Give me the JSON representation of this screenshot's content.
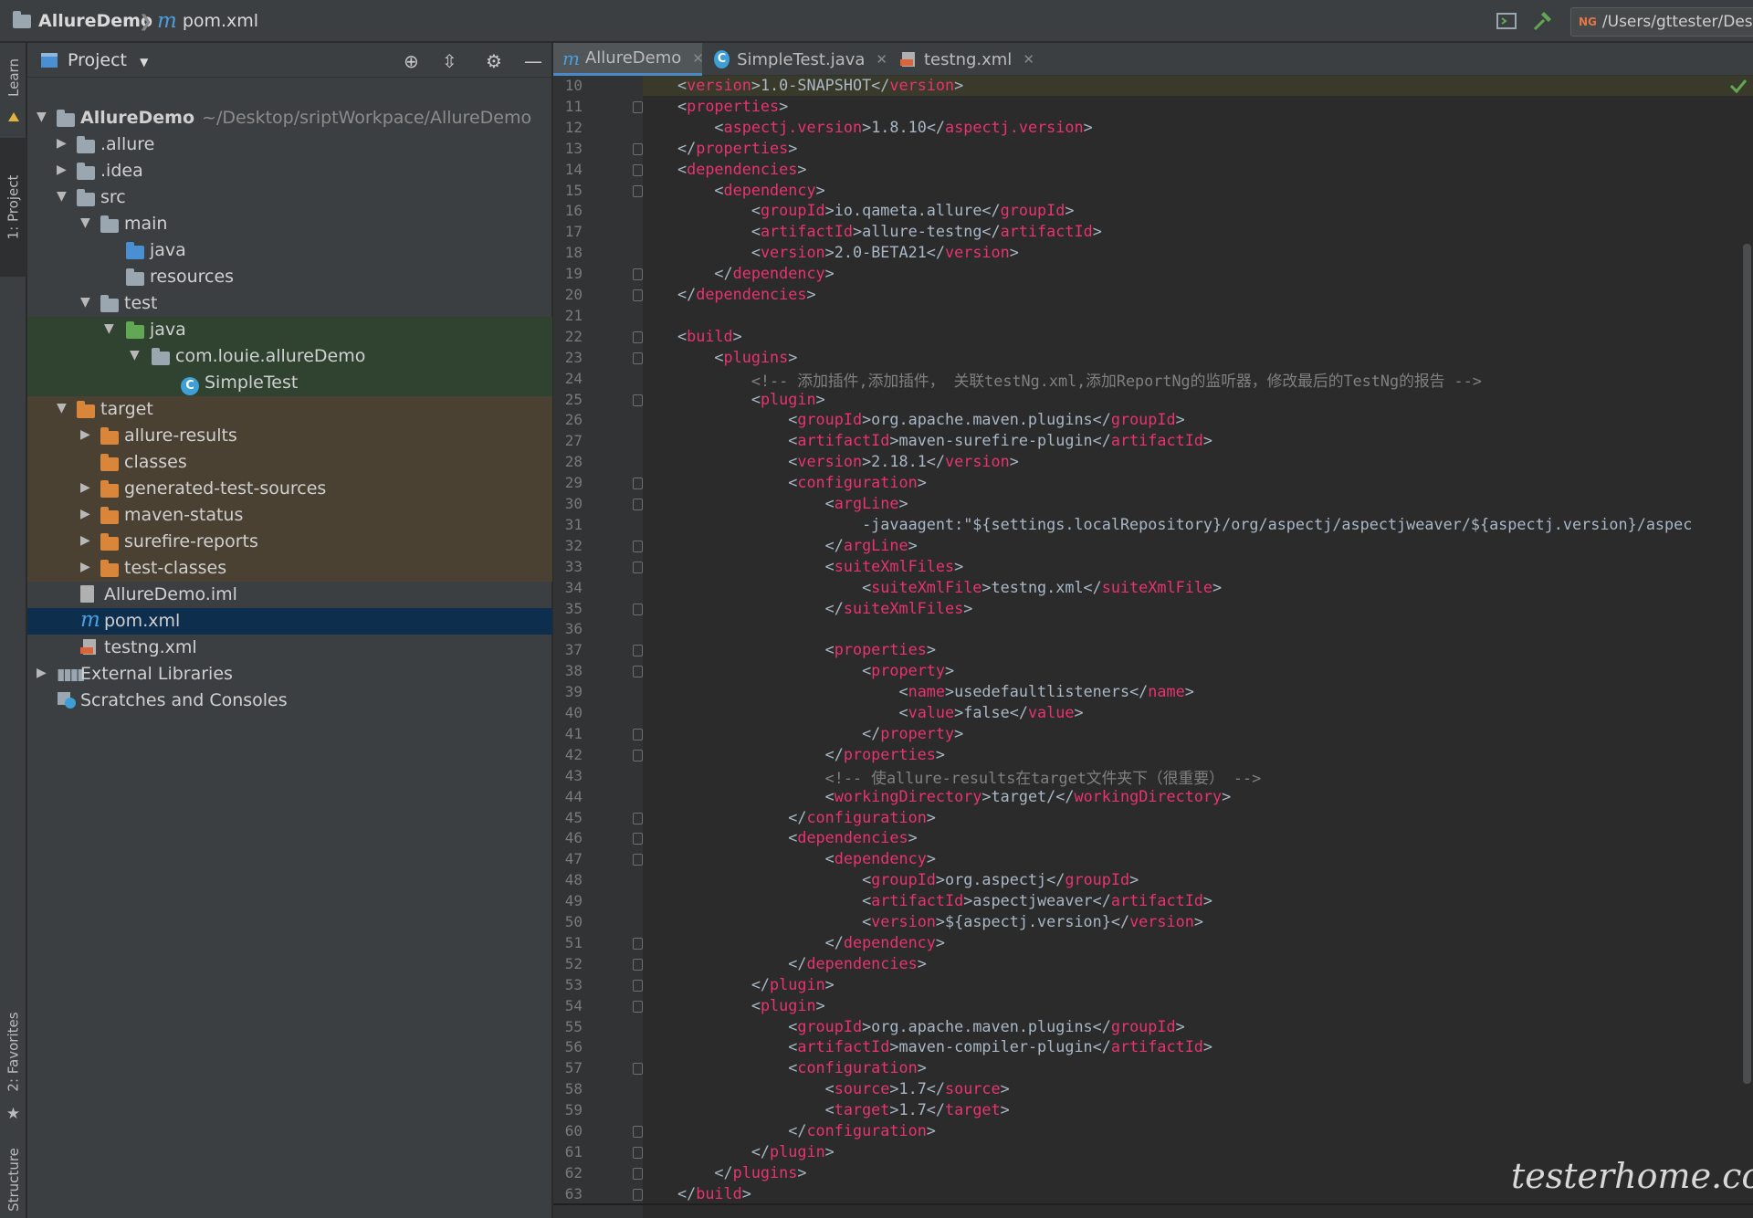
{
  "navbar": {
    "project": "AllureDemo",
    "file": "pom.xml",
    "run_config_badge": "NG",
    "path_field": "/Users/gttester/Desk"
  },
  "stripe": {
    "learn": "Learn",
    "project": "1: Project",
    "favorites": "2: Favorites",
    "structure": "Structure"
  },
  "project_panel": {
    "title": "Project",
    "tree": [
      {
        "label": "AllureDemo",
        "extra": "~/Desktop/sriptWorkpace/AllureDemo"
      },
      {
        "label": ".allure"
      },
      {
        "label": ".idea"
      },
      {
        "label": "src"
      },
      {
        "label": "main"
      },
      {
        "label": "java"
      },
      {
        "label": "resources"
      },
      {
        "label": "test"
      },
      {
        "label": "java"
      },
      {
        "label": "com.louie.allureDemo"
      },
      {
        "label": "SimpleTest"
      },
      {
        "label": "target"
      },
      {
        "label": "allure-results"
      },
      {
        "label": "classes"
      },
      {
        "label": "generated-test-sources"
      },
      {
        "label": "maven-status"
      },
      {
        "label": "surefire-reports"
      },
      {
        "label": "test-classes"
      },
      {
        "label": "AllureDemo.iml"
      },
      {
        "label": "pom.xml"
      },
      {
        "label": "testng.xml"
      },
      {
        "label": "External Libraries"
      },
      {
        "label": "Scratches and Consoles"
      }
    ]
  },
  "tabs": [
    {
      "label": "AllureDemo"
    },
    {
      "label": "SimpleTest.java"
    },
    {
      "label": "testng.xml"
    }
  ],
  "code_lines": [
    {
      "n": "10",
      "text": "<version>1.0-SNAPSHOT</version>"
    },
    {
      "n": "11",
      "text": "<properties>"
    },
    {
      "n": "12",
      "text": "    <aspectj.version>1.8.10</aspectj.version>"
    },
    {
      "n": "13",
      "text": "</properties>"
    },
    {
      "n": "14",
      "text": "<dependencies>"
    },
    {
      "n": "15",
      "text": "    <dependency>"
    },
    {
      "n": "16",
      "text": "        <groupId>io.qameta.allure</groupId>"
    },
    {
      "n": "17",
      "text": "        <artifactId>allure-testng</artifactId>"
    },
    {
      "n": "18",
      "text": "        <version>2.0-BETA21</version>"
    },
    {
      "n": "19",
      "text": "    </dependency>"
    },
    {
      "n": "20",
      "text": "</dependencies>"
    },
    {
      "n": "21",
      "text": ""
    },
    {
      "n": "22",
      "text": "<build>"
    },
    {
      "n": "23",
      "text": "    <plugins>"
    },
    {
      "n": "24",
      "text": "        <!-- 添加插件,添加插件， 关联testNg.xml,添加ReportNg的监听器，修改最后的TestNg的报告 -->"
    },
    {
      "n": "25",
      "text": "        <plugin>"
    },
    {
      "n": "26",
      "text": "            <groupId>org.apache.maven.plugins</groupId>"
    },
    {
      "n": "27",
      "text": "            <artifactId>maven-surefire-plugin</artifactId>"
    },
    {
      "n": "28",
      "text": "            <version>2.18.1</version>"
    },
    {
      "n": "29",
      "text": "            <configuration>"
    },
    {
      "n": "30",
      "text": "                <argLine>"
    },
    {
      "n": "31",
      "text": "                    -javaagent:\"${settings.localRepository}/org/aspectj/aspectjweaver/${aspectj.version}/aspec"
    },
    {
      "n": "32",
      "text": "                </argLine>"
    },
    {
      "n": "33",
      "text": "                <suiteXmlFiles>"
    },
    {
      "n": "34",
      "text": "                    <suiteXmlFile>testng.xml</suiteXmlFile>"
    },
    {
      "n": "35",
      "text": "                </suiteXmlFiles>"
    },
    {
      "n": "36",
      "text": ""
    },
    {
      "n": "37",
      "text": "                <properties>"
    },
    {
      "n": "38",
      "text": "                    <property>"
    },
    {
      "n": "39",
      "text": "                        <name>usedefaultlisteners</name>"
    },
    {
      "n": "40",
      "text": "                        <value>false</value>"
    },
    {
      "n": "41",
      "text": "                    </property>"
    },
    {
      "n": "42",
      "text": "                </properties>"
    },
    {
      "n": "43",
      "text": "                <!-- 使allure-results在target文件夹下（很重要） -->"
    },
    {
      "n": "44",
      "text": "                <workingDirectory>target/</workingDirectory>"
    },
    {
      "n": "45",
      "text": "            </configuration>"
    },
    {
      "n": "46",
      "text": "            <dependencies>"
    },
    {
      "n": "47",
      "text": "                <dependency>"
    },
    {
      "n": "48",
      "text": "                    <groupId>org.aspectj</groupId>"
    },
    {
      "n": "49",
      "text": "                    <artifactId>aspectjweaver</artifactId>"
    },
    {
      "n": "50",
      "text": "                    <version>${aspectj.version}</version>"
    },
    {
      "n": "51",
      "text": "                </dependency>"
    },
    {
      "n": "52",
      "text": "            </dependencies>"
    },
    {
      "n": "53",
      "text": "        </plugin>"
    },
    {
      "n": "54",
      "text": "        <plugin>"
    },
    {
      "n": "55",
      "text": "            <groupId>org.apache.maven.plugins</groupId>"
    },
    {
      "n": "56",
      "text": "            <artifactId>maven-compiler-plugin</artifactId>"
    },
    {
      "n": "57",
      "text": "            <configuration>"
    },
    {
      "n": "58",
      "text": "                <source>1.7</source>"
    },
    {
      "n": "59",
      "text": "                <target>1.7</target>"
    },
    {
      "n": "60",
      "text": "            </configuration>"
    },
    {
      "n": "61",
      "text": "        </plugin>"
    },
    {
      "n": "62",
      "text": "    </plugins>"
    },
    {
      "n": "63",
      "text": "</build>"
    }
  ],
  "watermark": "testerhome.com"
}
